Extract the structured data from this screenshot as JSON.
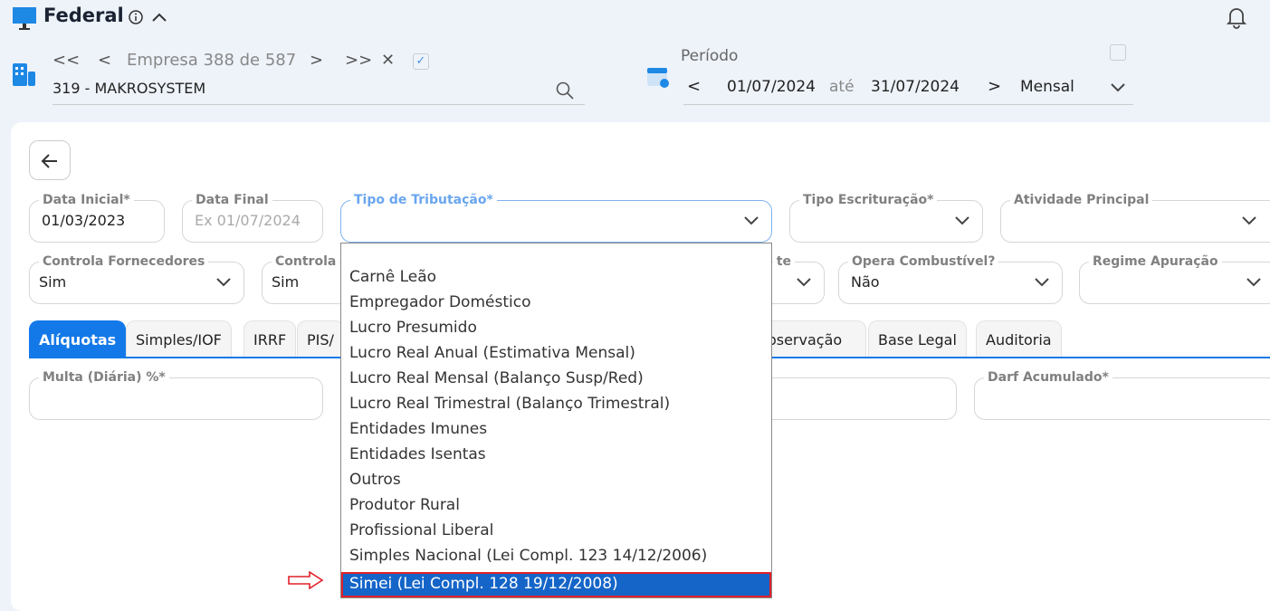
{
  "header": {
    "title": "Federal",
    "company_nav": "Empresa 388 de 587",
    "company": "319 - MAKROSYSTEM",
    "period_label": "Período",
    "date_from": "01/07/2024",
    "ate": "até",
    "date_to": "31/07/2024",
    "period_type": "Mensal"
  },
  "fields": {
    "data_inicial": {
      "label": "Data Inicial*",
      "value": "01/03/2023"
    },
    "data_final": {
      "label": "Data Final",
      "placeholder": "Ex 01/07/2024"
    },
    "tipo_tributacao": {
      "label": "Tipo de Tributação*"
    },
    "tipo_escrituracao": {
      "label": "Tipo Escrituração*"
    },
    "atividade_principal": {
      "label": "Atividade Principal"
    },
    "controla_fornecedores": {
      "label": "Controla Fornecedores",
      "value": "Sim"
    },
    "controla": {
      "label": "Controla",
      "value": "Sim"
    },
    "partial": {
      "label": "te"
    },
    "opera_combustivel": {
      "label": "Opera Combustível?",
      "value": "Não"
    },
    "regime_apuracao": {
      "label": "Regime Apuração"
    },
    "multa": {
      "label": "Multa (Diária) %*"
    },
    "darf": {
      "label": "Darf Acumulado*"
    }
  },
  "tabs": [
    "Alíquotas",
    "Simples/IOF",
    "IRRF",
    "PIS/",
    "Observação",
    "Base Legal",
    "Auditoria"
  ],
  "dropdown": {
    "options": [
      "Carnê Leão",
      "Empregador Doméstico",
      "Lucro Presumido",
      "Lucro Real Anual (Estimativa Mensal)",
      "Lucro Real Mensal (Balanço Susp/Red)",
      "Lucro Real Trimestral (Balanço Trimestral)",
      "Entidades Imunes",
      "Entidades Isentas",
      "Outros",
      "Produtor Rural",
      "Profissional Liberal",
      "Simples Nacional (Lei Compl. 123 14/12/2006)",
      "Simei (Lei Compl. 128 19/12/2008)"
    ],
    "selected": "Simei (Lei Compl. 128 19/12/2008)"
  },
  "colors": {
    "accent": "#1479e8",
    "selected": "#1565c8",
    "highlight": "#e0202a"
  }
}
